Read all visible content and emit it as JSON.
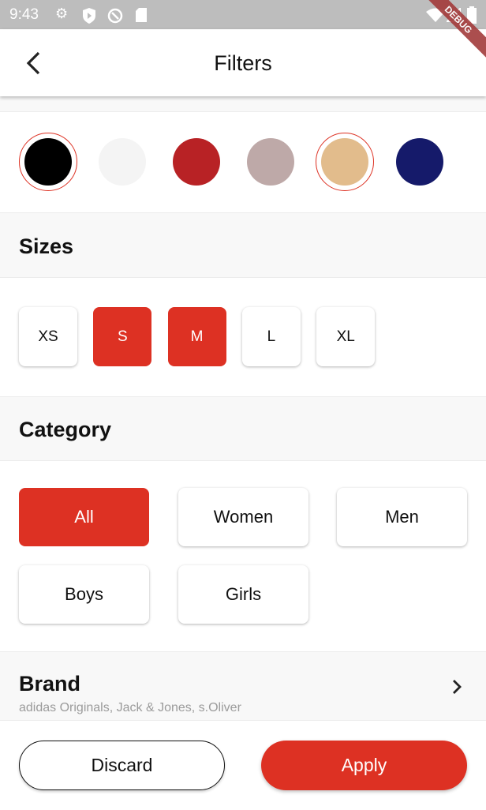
{
  "status": {
    "time": "9:43",
    "debug_banner": "DEBUG"
  },
  "appbar": {
    "title": "Filters"
  },
  "colors": {
    "swatches": [
      {
        "hex": "#000000",
        "selected": true
      },
      {
        "hex": "#f4f4f4",
        "selected": false
      },
      {
        "hex": "#b82225",
        "selected": false
      },
      {
        "hex": "#bea9a8",
        "selected": false
      },
      {
        "hex": "#e2bc8c",
        "selected": true
      },
      {
        "hex": "#151a6a",
        "selected": false
      }
    ],
    "accent": "#dd3123"
  },
  "sizes": {
    "title": "Sizes",
    "items": [
      {
        "label": "XS",
        "selected": false
      },
      {
        "label": "S",
        "selected": true
      },
      {
        "label": "M",
        "selected": true
      },
      {
        "label": "L",
        "selected": false
      },
      {
        "label": "XL",
        "selected": false
      }
    ]
  },
  "category": {
    "title": "Category",
    "items": [
      {
        "label": "All",
        "selected": true
      },
      {
        "label": "Women",
        "selected": false
      },
      {
        "label": "Men",
        "selected": false
      },
      {
        "label": "Boys",
        "selected": false
      },
      {
        "label": "Girls",
        "selected": false
      }
    ]
  },
  "brand": {
    "title": "Brand",
    "subtitle": "adidas Originals, Jack & Jones, s.Oliver"
  },
  "actions": {
    "discard": "Discard",
    "apply": "Apply"
  }
}
